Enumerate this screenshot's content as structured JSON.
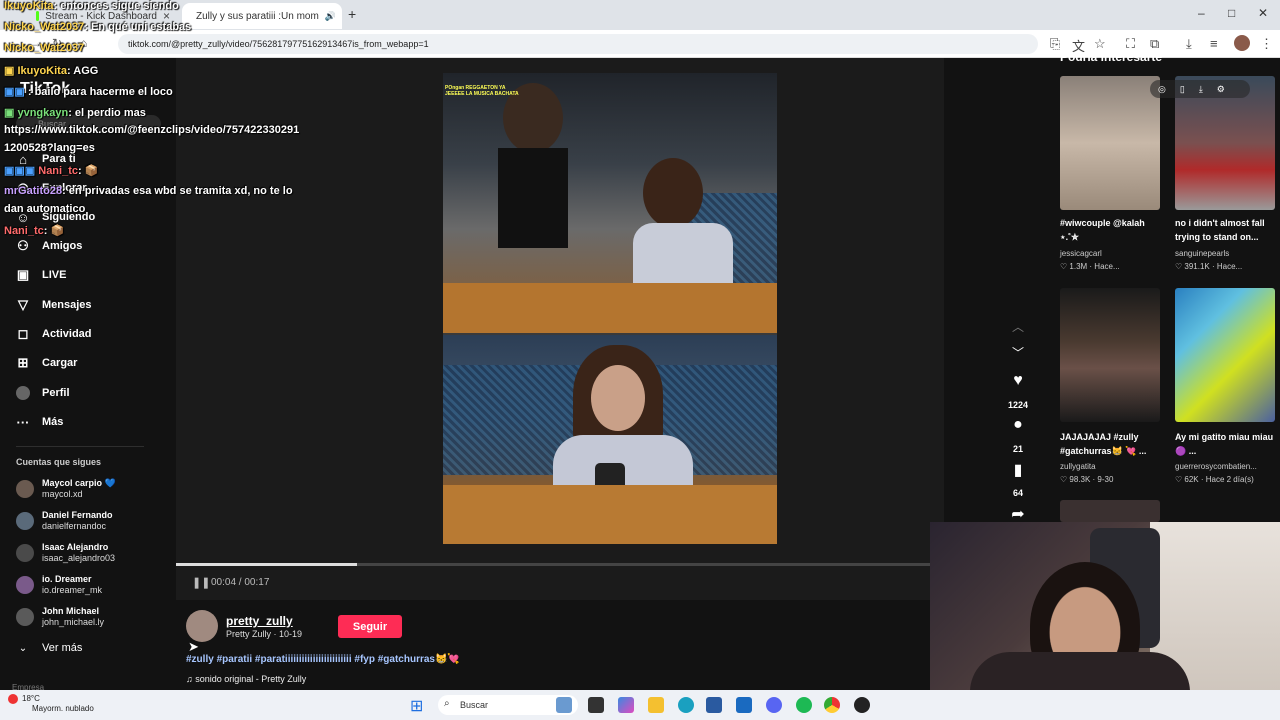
{
  "browser": {
    "tabs": [
      {
        "title": "Stream - Kick Dashboard"
      },
      {
        "title": "Zully y sus paratiii :Un mom"
      }
    ],
    "url": "tiktok.com/@pretty_zully/video/75628179775162913467is_from_webapp=1"
  },
  "sidebar": {
    "logo": "TikTok",
    "search_placeholder": "Buscar",
    "nav": [
      {
        "label": "Para ti",
        "icon": "home-icon"
      },
      {
        "label": "Explorar",
        "icon": "compass-icon"
      },
      {
        "label": "Siguiendo",
        "icon": "following-icon"
      },
      {
        "label": "Amigos",
        "icon": "friends-icon"
      },
      {
        "label": "LIVE",
        "icon": "live-icon"
      },
      {
        "label": "Mensajes",
        "icon": "messages-icon"
      },
      {
        "label": "Actividad",
        "icon": "activity-icon"
      },
      {
        "label": "Cargar",
        "icon": "upload-icon"
      },
      {
        "label": "Perfil",
        "icon": "profile-icon"
      },
      {
        "label": "Más",
        "icon": "more-icon"
      }
    ],
    "following_heading": "Cuentas que sigues",
    "following": [
      {
        "name": "Maycol carpio 💙",
        "user": "maycol.xd"
      },
      {
        "name": "Daniel Fernando",
        "user": "danielfernandoc"
      },
      {
        "name": "Isaac Alejandro",
        "user": "isaac_alejandro03"
      },
      {
        "name": "io. Dreamer",
        "user": "io.dreamer_mk"
      },
      {
        "name": "John Michael",
        "user": "john_michael.ly"
      }
    ],
    "see_more": "Ver más",
    "footer_partial": "Empresa"
  },
  "chat": [
    {
      "user": "IkuyoKita",
      "text": ": entonces sigue siendo"
    },
    {
      "user": "Nicko_Wat2037",
      "text": ": En qué uni estabas"
    },
    {
      "user": "Nicko_Wat2037",
      "text": ""
    },
    {
      "user": "IkuyoKita",
      "text": ": AGG"
    },
    {
      "user": "",
      "text": ": bailo para hacerme el loco"
    },
    {
      "user": "yvngkayn",
      "text": ": el perdio mas"
    },
    {
      "user": "",
      "text": "https://www.tiktok.com/@feenzclips/video/757422330291"
    },
    {
      "user": "",
      "text": "1200528?lang=es"
    },
    {
      "user": "Nani_tc",
      "text": ": 📦"
    },
    {
      "user": "mrGatito28",
      "text": ": en privadas esa wbd se tramita xd, no te lo"
    },
    {
      "user": "",
      "text": "dan automatico"
    },
    {
      "user": "Nani_tc",
      "text": ": 📦"
    }
  ],
  "player": {
    "current_time": "00:04",
    "duration": "00:17",
    "time_display": "00:04 / 00:17",
    "progress_fraction": 0.24,
    "overlay_text_1": "POngan REGGAETON YA",
    "overlay_text_2": "JEEEEE LA MUSICA BACHATA"
  },
  "actions": {
    "likes": "1224",
    "comments": "21",
    "saves": "64"
  },
  "post": {
    "username": "pretty_zully",
    "subline": "Pretty Zully · 10-19",
    "follow_label": "Seguir",
    "hashtags": "#zully #paratii #paratiiiiiiiiiiiiiiiiiiiiiiii #fyp #gatchurras😸💘",
    "sound": "♫ sonido original - Pretty Zully"
  },
  "right": {
    "heading": "Podría interesarte",
    "cards": [
      {
        "title": "#wiwcouple @kalah ⋆.˚✮",
        "user": "jessicagcarl",
        "stats": "♡ 1.3M · Hace..."
      },
      {
        "title": "no i didn't almost fall trying to stand on...",
        "user": "sanguinepearls",
        "stats": "♡ 391.1K · Hace..."
      },
      {
        "title": "JAJAJAJAJ #zully #gatchurras😸 💘 ...",
        "user": "zullygatita",
        "stats": "♡ 98.3K · 9-30"
      },
      {
        "title": "Ay mi gatito miau miau 🟣 ...",
        "user": "guerrerosycombatien...",
        "stats": "♡ 62K · Hace 2 día(s)"
      }
    ]
  },
  "taskbar": {
    "temp": "18°C",
    "weather": "Mayorm. nublado",
    "search": "Buscar"
  }
}
